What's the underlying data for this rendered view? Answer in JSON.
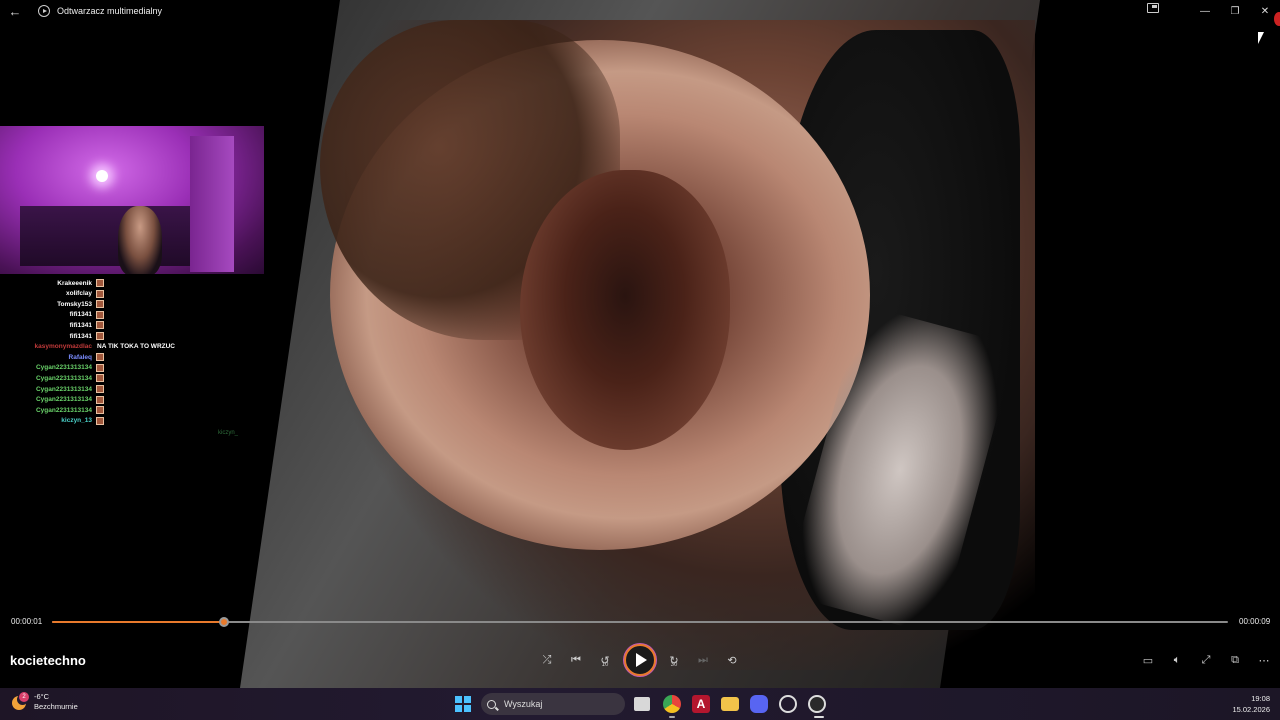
{
  "window": {
    "title": "Odtwarzacz multimedialny",
    "back_glyph": "←",
    "compact_glyph": "compact-overlay-icon",
    "minimize_glyph": "—",
    "maximize_glyph": "❐",
    "close_glyph": "✕"
  },
  "chat": {
    "rows": [
      {
        "user": "Krakeeenik",
        "color": "#ffffff",
        "msg": ""
      },
      {
        "user": "xolifclay",
        "color": "#ffffff",
        "msg": ""
      },
      {
        "user": "Tomsky153",
        "color": "#ffffff",
        "msg": ""
      },
      {
        "user": "fifi1341",
        "color": "#ffffff",
        "msg": ""
      },
      {
        "user": "fifi1341",
        "color": "#ffffff",
        "msg": ""
      },
      {
        "user": "fifi1341",
        "color": "#ffffff",
        "msg": ""
      },
      {
        "user": "kasymonymazdlac",
        "color": "#c23a3a",
        "msg": "NA TIK TOKA TO WRZUC"
      },
      {
        "user": "Rafaleq",
        "color": "#7b8cff",
        "msg": ""
      },
      {
        "user": "Cygan2231313134",
        "color": "#6ad36a",
        "msg": ""
      },
      {
        "user": "Cygan2231313134",
        "color": "#6ad36a",
        "msg": ""
      },
      {
        "user": "Cygan2231313134",
        "color": "#6ad36a",
        "msg": ""
      },
      {
        "user": "Cygan2231313134",
        "color": "#6ad36a",
        "msg": ""
      },
      {
        "user": "Cygan2231313134",
        "color": "#6ad36a",
        "msg": ""
      },
      {
        "user": "kiczyn_13",
        "color": "#4ad0c8",
        "msg": ""
      }
    ],
    "ghost_text": "kiczyn_"
  },
  "player": {
    "current_time": "00:00:01",
    "total_time": "00:00:09",
    "progress": 0.146,
    "media_title": "kocietechno",
    "skip_back_seconds": "10",
    "skip_forward_seconds": "30",
    "accent_color": "#e87a2c"
  },
  "taskbar": {
    "weather_temp": "-6°C",
    "weather_desc": "Bezchmurnie",
    "weather_badge": "2",
    "search_placeholder": "Wyszukaj",
    "clock_time": "19:08",
    "clock_date": "15.02.2026"
  }
}
